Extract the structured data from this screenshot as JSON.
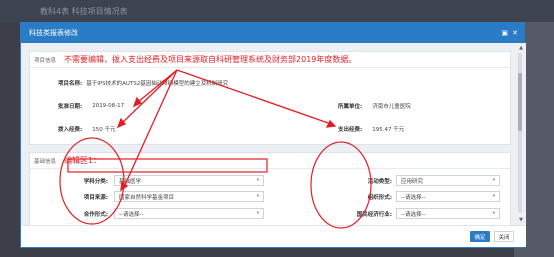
{
  "background": {
    "title": "教科4表 科技项目情况表"
  },
  "modal": {
    "title": "科技类报表修改",
    "controls": {
      "maximize": "▣",
      "close": "✕"
    },
    "section1": {
      "label": "项目信息",
      "annotation": "不需要编辑，拨入支出经费及项目来源取自科研管理系统及财务部2019年度数据。",
      "project_name_label": "项目名称:",
      "project_name_value": "基于IPS技术的AUTS2基因抽动障碍模型的建立及机制研究",
      "approve_date_label": "批准日期:",
      "approve_date_value": "2019-08-17",
      "unit_label": "所属单位:",
      "unit_value": "济南市儿童医院",
      "income_label": "拨入经费:",
      "income_value": "150 千元",
      "expense_label": "支出经费:",
      "expense_value": "195.47 千元"
    },
    "section2": {
      "label": "基础信息",
      "annotation": "编辑区1：",
      "fields": {
        "discipline_label": "学科分类:",
        "discipline_value": "基础医学",
        "activity_label": "活动类型:",
        "activity_value": "应用研究",
        "source_label": "项目来源:",
        "source_value": "国家自然科学基金项目",
        "org_form_label": "组织形式:",
        "org_form_value": "--请选择--",
        "coop_label": "合作形式:",
        "coop_value": "--请选择--",
        "economy_label": "国民经济行业:",
        "economy_value": "--请选择--"
      }
    },
    "footer": {
      "ok": "确定",
      "close": "关闭"
    }
  },
  "colors": {
    "accent": "#2b7cc6",
    "annotation": "#e21f26"
  }
}
